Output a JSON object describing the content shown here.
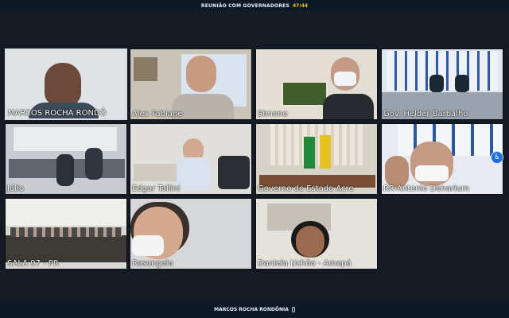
{
  "header": {
    "title": "REUNIÃO COM GOVERNADORES",
    "timer": "47:44"
  },
  "footer": {
    "active_speaker": "MARCOS ROCHA RONDÔNIA"
  },
  "participants": [
    {
      "name": "MARCOS ROCHA RONDÔ"
    },
    {
      "name": "Alex Fabiane"
    },
    {
      "name": "Simone"
    },
    {
      "name": "Gov. Helder Barbalho"
    },
    {
      "name": "Júlio"
    },
    {
      "name": "Edgar Tollini"
    },
    {
      "name": "Governo do Estado Acre"
    },
    {
      "name": "RR-Antonio Denarium"
    },
    {
      "name": "SALA 97 - PR"
    },
    {
      "name": "Rosangela"
    },
    {
      "name": "Daniela Uchôa - Amapá"
    }
  ],
  "icons": {
    "side_button": "accessibility-icon",
    "mic": "microphone-icon"
  },
  "colors": {
    "background": "#141b24",
    "bar": "#0d1a26",
    "timer": "#f0c419",
    "accent": "#1e6fd8"
  }
}
